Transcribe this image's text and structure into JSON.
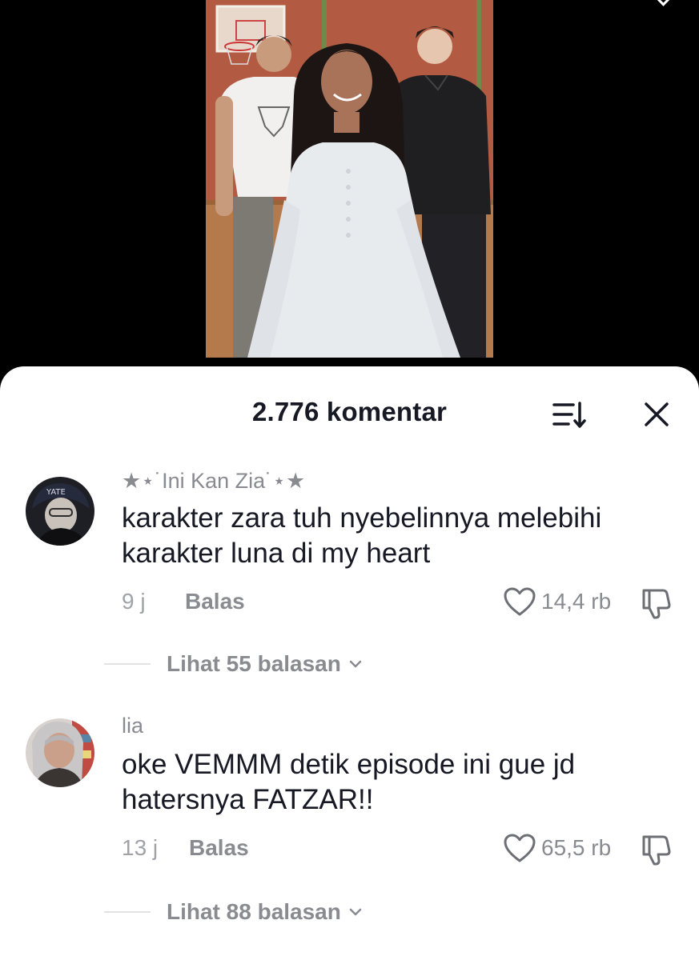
{
  "video": {
    "background_color": "#000000"
  },
  "sheet": {
    "title": "2.776 komentar",
    "sort_icon": "sort-icon",
    "close_icon": "close-icon"
  },
  "comments": [
    {
      "username": "★⋆˙Ini Kan Zia˙⋆★",
      "text": "karakter zara tuh nyebelinnya melebihi karakter luna di my heart",
      "time": "9 j",
      "reply_label": "Balas",
      "likes": "14,4 rb",
      "view_replies": "Lihat 55 balasan"
    },
    {
      "username": "lia",
      "text": "oke VEMMM detik episode ini gue jd hatersnya FATZAR!!",
      "time": "13 j",
      "reply_label": "Balas",
      "likes": "65,5 rb",
      "view_replies": "Lihat 88 balasan"
    }
  ],
  "colors": {
    "primary_text": "#161823",
    "secondary_text": "#8a8b91",
    "sheet_background": "#ffffff"
  }
}
